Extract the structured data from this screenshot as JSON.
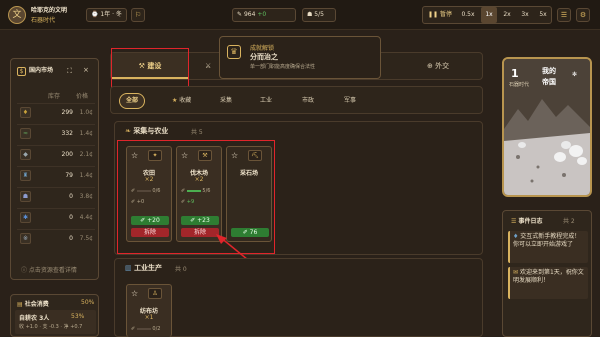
{
  "header": {
    "logo_glyph": "文",
    "civ_name": "哈耶克的文明",
    "era": "石器时代",
    "date": "1年 · 冬",
    "stat_a_value": "964",
    "stat_a_delta": "+0",
    "stat_b": "5/5",
    "pause_label": "暂停",
    "speeds": [
      "0.5x",
      "1x",
      "2x",
      "3x",
      "5x"
    ],
    "active_speed": "1x"
  },
  "market": {
    "title": "国内市场",
    "col_stock": "库存",
    "col_price": "价格",
    "rows": [
      {
        "icon": "grain-icon",
        "glyph": "♦",
        "color": "#c9a23a",
        "stock": "299",
        "price": "1.0¢"
      },
      {
        "icon": "wood-icon",
        "glyph": "≈",
        "color": "#5fa05a",
        "stock": "332",
        "price": "1.4¢"
      },
      {
        "icon": "stone-icon",
        "glyph": "◆",
        "color": "#9aa7ad",
        "stock": "200",
        "price": "2.1¢"
      },
      {
        "icon": "tool-icon",
        "glyph": "♜",
        "color": "#6ea0c8",
        "stock": "79",
        "price": "1.4¢"
      },
      {
        "icon": "cloth-icon",
        "glyph": "☗",
        "color": "#8c9bd0",
        "stock": "0",
        "price": "3.8¢"
      },
      {
        "icon": "ore-icon",
        "glyph": "✱",
        "color": "#5a8fd8",
        "stock": "0",
        "price": "4.4¢"
      },
      {
        "icon": "metal-icon",
        "glyph": "※",
        "color": "#9fb0c0",
        "stock": "0",
        "price": "7.5¢"
      }
    ],
    "footer": "点击资源查看详情"
  },
  "policy": {
    "title": "社会消费",
    "percent": "50%",
    "row_label": "自耕农 3人",
    "row_percent": "53%",
    "row_detail": "收 +1.0 · 支 -0.3 · 净 +0.7"
  },
  "tabs": [
    "建设",
    "人口",
    "政策",
    "行政",
    "外交"
  ],
  "active_tab": "建设",
  "subtabs": [
    "全部",
    "收藏",
    "采集",
    "工业",
    "市政",
    "军事"
  ],
  "active_subtab": "全部",
  "tooltip": {
    "tag": "成就解锁",
    "title": "分而治之",
    "desc": "单一部门职能高度确保合法性"
  },
  "section_gather": {
    "title": "采集与农业",
    "count": "共 5",
    "cards": [
      {
        "name": "农田",
        "count": "×2",
        "line1": "0/6",
        "line2": "+0",
        "green": "+20",
        "red": "拆除"
      },
      {
        "name": "伐木场",
        "count": "×2",
        "line1": "5/6",
        "line2": "+9",
        "green": "+23",
        "red": "拆除"
      },
      {
        "name": "采石场",
        "count": "",
        "line1": "",
        "line2": "",
        "green": "76",
        "red": ""
      }
    ]
  },
  "section_industry": {
    "title": "工业生产",
    "count": "共 0",
    "cards": [
      {
        "name": "纺布坊",
        "count": "×1",
        "line1": "0/2"
      }
    ]
  },
  "country": {
    "year": "1",
    "season": "石器时代",
    "name_line1": "我的",
    "name_line2": "帝国"
  },
  "log": {
    "title": "事件日志",
    "count": "共 2",
    "items": [
      "交互式新手教程完成！你可以立即开始游戏了",
      "欢迎来到第1天，祝你文明发展顺利！"
    ]
  }
}
